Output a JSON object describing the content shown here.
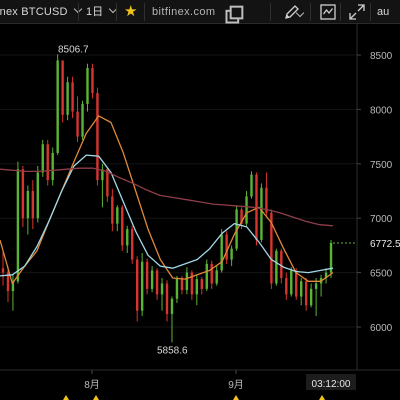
{
  "toolbar": {
    "symbol": "inex BTCUSD",
    "interval": "1日",
    "site": "bitfinex.com",
    "auto_label": "au",
    "icons": [
      "star-icon",
      "external-link-icon",
      "pencil-icon",
      "chevron-down-icon",
      "chart-template-icon",
      "fullscreen-icon"
    ]
  },
  "colors": {
    "up": "#5ab534",
    "down": "#d8352f",
    "ma_fast": "#e0883a",
    "ma_mid": "#9fd8e8",
    "ma_slow": "#8f3e48",
    "background": "#000000",
    "axis_text": "#b9b9b9",
    "star": "#f0c419"
  },
  "chart_data": {
    "type": "candlestick",
    "y_ticks": [
      "8500",
      "8000",
      "7500",
      "7000",
      "6500",
      "6000"
    ],
    "ylim": [
      5450,
      8800
    ],
    "x_labels": [
      "8月",
      "9月"
    ],
    "time_label": "03:12:00",
    "last_price": "6772.5",
    "annotations": {
      "high": "8506.7",
      "low": "5858.6"
    },
    "candles": [
      [
        6540,
        6690,
        6380,
        6500
      ],
      [
        6500,
        6560,
        6230,
        6330
      ],
      [
        6330,
        6480,
        6150,
        6420
      ],
      [
        6420,
        7520,
        6400,
        7450
      ],
      [
        7450,
        7480,
        6920,
        7000
      ],
      [
        7000,
        7300,
        6850,
        7250
      ],
      [
        7250,
        7350,
        6900,
        7000
      ],
      [
        7000,
        7480,
        6960,
        7420
      ],
      [
        7420,
        7720,
        7380,
        7680
      ],
      [
        7680,
        7720,
        7300,
        7350
      ],
      [
        7350,
        7650,
        7300,
        7600
      ],
      [
        7600,
        8506.7,
        7580,
        8450
      ],
      [
        8450,
        8420,
        7880,
        7950
      ],
      [
        7950,
        8300,
        7900,
        8250
      ],
      [
        8250,
        8300,
        7920,
        7980
      ],
      [
        7980,
        8120,
        7700,
        7750
      ],
      [
        7750,
        8080,
        7720,
        8050
      ],
      [
        8050,
        8420,
        7980,
        8380
      ],
      [
        8380,
        8420,
        8100,
        8150
      ],
      [
        8150,
        8200,
        7300,
        7350
      ],
      [
        7350,
        7500,
        7100,
        7450
      ],
      [
        7450,
        7470,
        7150,
        7200
      ],
      [
        7200,
        7270,
        6880,
        6950
      ],
      [
        6950,
        7120,
        6880,
        7100
      ],
      [
        7100,
        7120,
        6700,
        6750
      ],
      [
        6750,
        6930,
        6680,
        6900
      ],
      [
        6900,
        6930,
        6580,
        6620
      ],
      [
        6620,
        6650,
        6050,
        6150
      ],
      [
        6150,
        6680,
        6100,
        6600
      ],
      [
        6600,
        6630,
        6300,
        6350
      ],
      [
        6350,
        6560,
        6320,
        6520
      ],
      [
        6520,
        6540,
        6250,
        6300
      ],
      [
        6300,
        6450,
        6150,
        6400
      ],
      [
        6400,
        6430,
        6050,
        6120
      ],
      [
        6120,
        6280,
        5858.6,
        6260
      ],
      [
        6260,
        6470,
        6220,
        6450
      ],
      [
        6450,
        6470,
        6300,
        6340
      ],
      [
        6340,
        6550,
        6300,
        6500
      ],
      [
        6500,
        6520,
        6250,
        6300
      ],
      [
        6300,
        6480,
        6200,
        6440
      ],
      [
        6440,
        6460,
        6300,
        6350
      ],
      [
        6350,
        6620,
        6330,
        6580
      ],
      [
        6580,
        6610,
        6350,
        6400
      ],
      [
        6400,
        6560,
        6380,
        6520
      ],
      [
        6520,
        6900,
        6500,
        6850
      ],
      [
        6850,
        6880,
        6580,
        6620
      ],
      [
        6620,
        6750,
        6560,
        6720
      ],
      [
        6720,
        7120,
        6700,
        7080
      ],
      [
        7080,
        7100,
        6900,
        6950
      ],
      [
        6950,
        7250,
        6930,
        7200
      ],
      [
        7200,
        7430,
        7180,
        7400
      ],
      [
        7400,
        7420,
        6750,
        6800
      ],
      [
        6800,
        7320,
        6780,
        7280
      ],
      [
        7280,
        7420,
        7020,
        7050
      ],
      [
        7050,
        7080,
        6350,
        6400
      ],
      [
        6400,
        6720,
        6380,
        6700
      ],
      [
        6700,
        6720,
        6400,
        6450
      ],
      [
        6450,
        6500,
        6250,
        6300
      ],
      [
        6300,
        6550,
        6280,
        6520
      ],
      [
        6520,
        6540,
        6250,
        6280
      ],
      [
        6280,
        6450,
        6200,
        6420
      ],
      [
        6420,
        6450,
        6150,
        6200
      ],
      [
        6200,
        6400,
        6180,
        6350
      ],
      [
        6350,
        6450,
        6100,
        6400
      ],
      [
        6400,
        6480,
        6280,
        6450
      ],
      [
        6450,
        6540,
        6400,
        6500
      ],
      [
        6500,
        6800,
        6450,
        6772.5
      ]
    ],
    "series": [
      {
        "values": [
          6800,
          6400,
          6560,
          6700,
          6980,
          7250,
          7520,
          7780,
          7940,
          7880,
          7600,
          7250,
          6900,
          6620,
          6450,
          6440,
          6480,
          6520,
          6600,
          6850,
          7050,
          7100,
          6960,
          6720,
          6500,
          6420,
          6420,
          6500
        ]
      },
      {
        "values": [
          6470,
          6480,
          6560,
          6740,
          6980,
          7250,
          7480,
          7580,
          7570,
          7420,
          7150,
          6880,
          6660,
          6560,
          6540,
          6580,
          6620,
          6720,
          6860,
          6950,
          6920,
          6780,
          6620,
          6550,
          6510,
          6500,
          6520,
          6540
        ]
      },
      {
        "values": [
          7450,
          7440,
          7430,
          7430,
          7440,
          7450,
          7460,
          7460,
          7430,
          7370,
          7320,
          7260,
          7210,
          7190,
          7170,
          7150,
          7130,
          7120,
          7110,
          7100,
          7080,
          7050,
          7010,
          6970,
          6940,
          6930
        ]
      }
    ]
  }
}
